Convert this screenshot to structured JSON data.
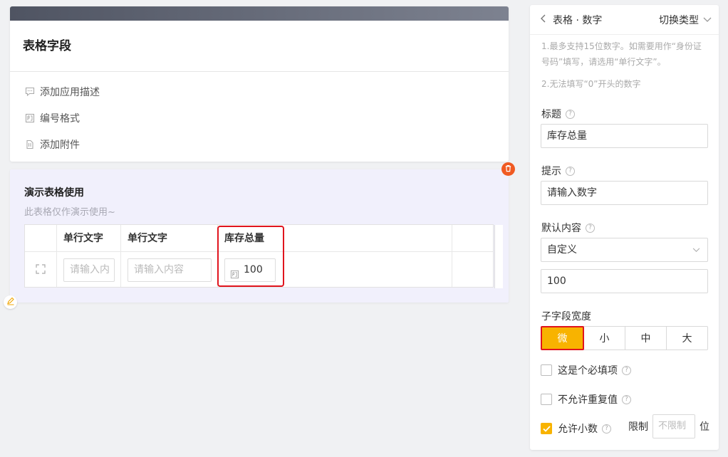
{
  "form": {
    "title": "表格字段",
    "actions": [
      {
        "label": "添加应用描述",
        "icon": "comment-icon"
      },
      {
        "label": "编号格式",
        "icon": "number-format-icon"
      },
      {
        "label": "添加附件",
        "icon": "attachment-icon"
      }
    ]
  },
  "demo": {
    "title": "演示表格使用",
    "desc": "此表格仅作演示使用~",
    "columns": [
      "单行文字",
      "单行文字",
      "库存总量"
    ],
    "row": {
      "c1_placeholder": "请输入内",
      "c2_placeholder": "请输入内容",
      "c3_value": "100"
    }
  },
  "panel": {
    "title": "表格 · 数字",
    "switch_label": "切换类型",
    "notes": [
      "1.最多支持15位数字。如需要用作“身份证号码”填写，请选用“单行文字”。",
      "2.无法填写“0”开头的数字"
    ],
    "title_label": "标题",
    "title_value": "库存总量",
    "hint_label": "提示",
    "hint_value": "请输入数字",
    "default_label": "默认内容",
    "default_select": "自定义",
    "default_value": "100",
    "width_label": "子字段宽度",
    "width_options": [
      "微",
      "小",
      "中",
      "大"
    ],
    "width_selected": "微",
    "required_label": "这是个必填项",
    "required_checked": false,
    "unique_label": "不允许重复值",
    "unique_checked": false,
    "decimal_label": "允许小数",
    "decimal_checked": true,
    "limit_label": "限制",
    "limit_placeholder": "不限制",
    "limit_unit": "位"
  },
  "colors": {
    "accent": "#f8b300",
    "highlight": "#e0141e",
    "delete": "#f05a22",
    "demo_bg": "#f1f0fc"
  }
}
